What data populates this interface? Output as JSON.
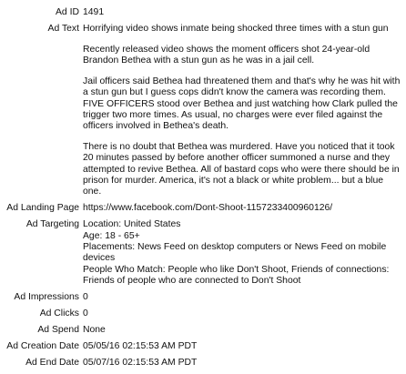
{
  "fields": {
    "ad_id": {
      "label": "Ad ID",
      "value": "1491"
    },
    "ad_text": {
      "label": "Ad Text",
      "paragraphs": [
        "Horrifying video shows inmate being shocked three times with a stun gun",
        "Recently released video shows the moment officers shot 24-year-old Brandon Bethea with a stun gun as he was in a jail cell.",
        "Jail officers said Bethea had threatened them and that's why he was hit with a stun gun but I guess cops didn't know the camera was recording them. FIVE OFFICERS stood over Bethea and just watching how Clark pulled the trigger two more times. As usual, no charges were ever filed against the officers involved in Bethea's death.",
        "There is no doubt that Bethea was murdered. Have you noticed that it took 20 minutes passed by before another officer summoned a nurse and they attempted to revive Bethea. All of bastard cops who were there should be in prison for murder. America, it's not a black or white problem... but a blue one."
      ]
    },
    "ad_landing_page": {
      "label": "Ad Landing Page",
      "value": "https://www.facebook.com/Dont-Shoot-1157233400960126/"
    },
    "ad_targeting": {
      "label": "Ad Targeting",
      "lines": [
        "Location: United States",
        "Age: 18 - 65+",
        "Placements: News Feed on desktop computers or News Feed on mobile devices",
        "People Who Match: People who like Don't Shoot, Friends of connections: Friends of people who are connected to Don't Shoot"
      ]
    },
    "ad_impressions": {
      "label": "Ad Impressions",
      "value": "0"
    },
    "ad_clicks": {
      "label": "Ad Clicks",
      "value": "0"
    },
    "ad_spend": {
      "label": "Ad Spend",
      "value": "None"
    },
    "ad_creation_date": {
      "label": "Ad Creation Date",
      "value": "05/05/16 02:15:53 AM PDT"
    },
    "ad_end_date": {
      "label": "Ad End Date",
      "value": "05/07/16 02:15:53 AM PDT"
    }
  }
}
